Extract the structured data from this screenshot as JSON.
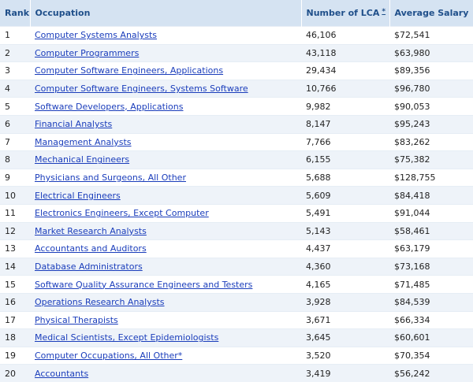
{
  "table": {
    "headers": {
      "rank": "Rank",
      "occupation": "Occupation",
      "lca": "Number of LCA",
      "lca_note": "*",
      "salary": "Average Salary"
    },
    "rows": [
      {
        "rank": "1",
        "occupation": "Computer Systems Analysts",
        "lca": "46,106",
        "salary": "$72,541"
      },
      {
        "rank": "2",
        "occupation": "Computer Programmers",
        "lca": "43,118",
        "salary": "$63,980"
      },
      {
        "rank": "3",
        "occupation": "Computer Software Engineers, Applications",
        "lca": "29,434",
        "salary": "$89,356"
      },
      {
        "rank": "4",
        "occupation": "Computer Software Engineers, Systems Software",
        "lca": "10,766",
        "salary": "$96,780"
      },
      {
        "rank": "5",
        "occupation": "Software Developers, Applications",
        "lca": "9,982",
        "salary": "$90,053"
      },
      {
        "rank": "6",
        "occupation": "Financial Analysts",
        "lca": "8,147",
        "salary": "$95,243"
      },
      {
        "rank": "7",
        "occupation": "Management Analysts",
        "lca": "7,766",
        "salary": "$83,262"
      },
      {
        "rank": "8",
        "occupation": "Mechanical Engineers",
        "lca": "6,155",
        "salary": "$75,382"
      },
      {
        "rank": "9",
        "occupation": "Physicians and Surgeons, All Other",
        "lca": "5,688",
        "salary": "$128,755"
      },
      {
        "rank": "10",
        "occupation": "Electrical Engineers",
        "lca": "5,609",
        "salary": "$84,418"
      },
      {
        "rank": "11",
        "occupation": "Electronics Engineers, Except Computer",
        "lca": "5,491",
        "salary": "$91,044"
      },
      {
        "rank": "12",
        "occupation": "Market Research Analysts",
        "lca": "5,143",
        "salary": "$58,461"
      },
      {
        "rank": "13",
        "occupation": "Accountants and Auditors",
        "lca": "4,437",
        "salary": "$63,179"
      },
      {
        "rank": "14",
        "occupation": "Database Administrators",
        "lca": "4,360",
        "salary": "$73,168"
      },
      {
        "rank": "15",
        "occupation": "Software Quality Assurance Engineers and Testers",
        "lca": "4,165",
        "salary": "$71,485"
      },
      {
        "rank": "16",
        "occupation": "Operations Research Analysts",
        "lca": "3,928",
        "salary": "$84,539"
      },
      {
        "rank": "17",
        "occupation": "Physical Therapists",
        "lca": "3,671",
        "salary": "$66,334"
      },
      {
        "rank": "18",
        "occupation": "Medical Scientists, Except Epidemiologists",
        "lca": "3,645",
        "salary": "$60,601"
      },
      {
        "rank": "19",
        "occupation": "Computer Occupations, All Other*",
        "lca": "3,520",
        "salary": "$70,354"
      },
      {
        "rank": "20",
        "occupation": "Accountants",
        "lca": "3,419",
        "salary": "$56,242"
      }
    ]
  }
}
